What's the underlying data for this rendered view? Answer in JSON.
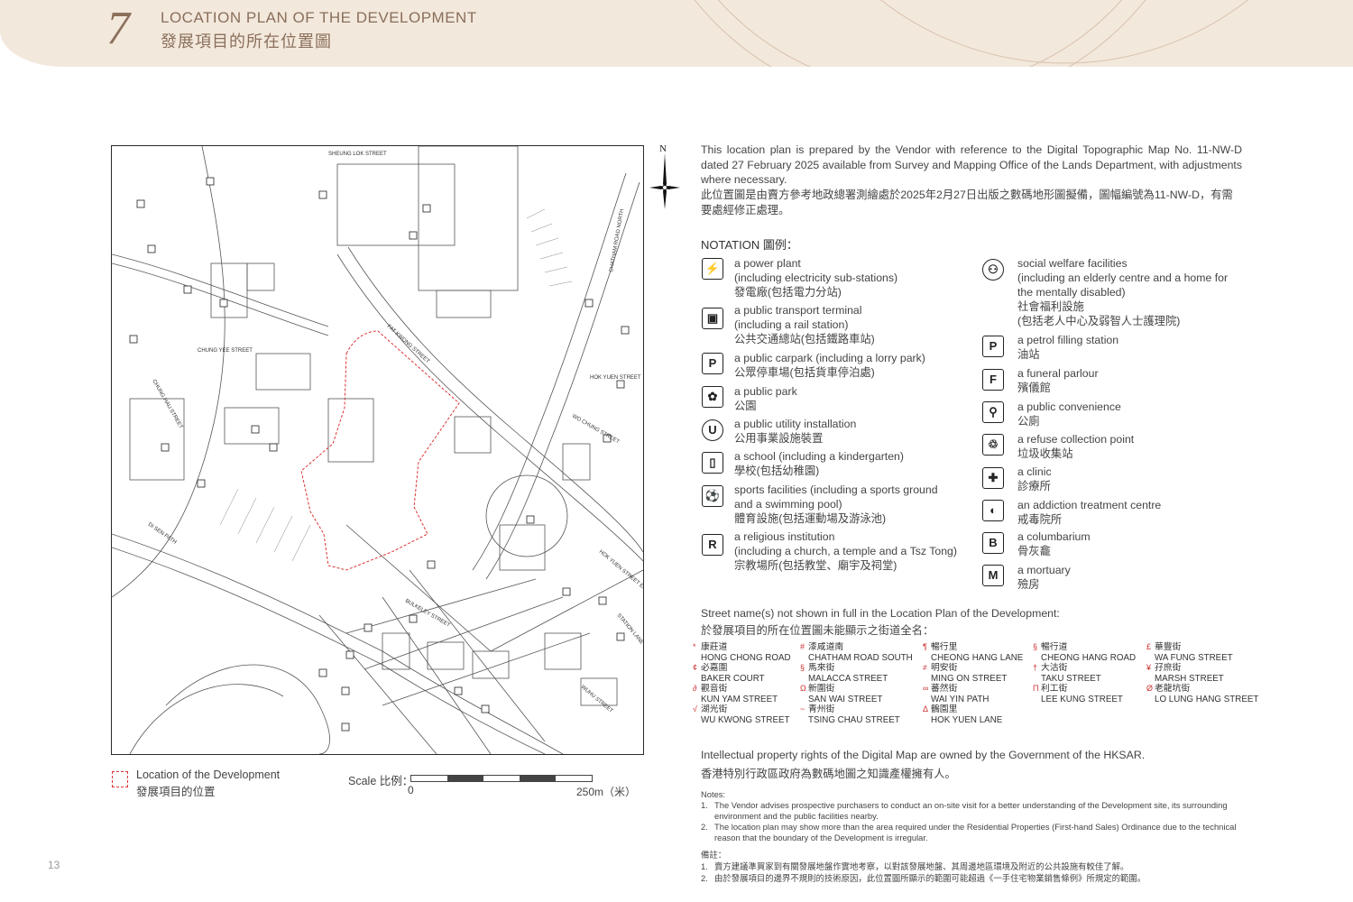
{
  "header": {
    "section_number": "7",
    "title_en": "LOCATION PLAN OF THE DEVELOPMENT",
    "title_zh": "發展項目的所在位置圖"
  },
  "map": {
    "north": "N",
    "labels": [
      "FAT KWONG STREET",
      "CHUNG YEE STREET",
      "CHUNG HAU STREET",
      "DI SEN PATH",
      "CHATHAM ROAD NORTH",
      "WO CHUNG STREET",
      "HOK YUEN STREET",
      "STATION LANE",
      "BULKELEY STREET",
      "WUHU STREET",
      "SHEUNG LOK STREET",
      "HOK YUEN STREET EAST"
    ],
    "legend_location_en": "Location of the Development",
    "legend_location_zh": "發展項目的位置",
    "scale_label": "Scale 比例：",
    "scale_start": "0",
    "scale_end": "250m（米）"
  },
  "intro": {
    "en": "This location plan is prepared by the Vendor with reference to the Digital Topographic Map No. 11-NW-D dated 27 February 2025 available from Survey and Mapping Office of the Lands Department, with adjustments where necessary.",
    "zh": "此位置圖是由賣方參考地政總署測繪處於2025年2月27日出版之數碼地形圖擬備，圖幅編號為11-NW-D，有需要處經修正處理。"
  },
  "notation": {
    "title": "NOTATION 圖例：",
    "left": [
      {
        "icon": "power-plant-icon",
        "glyph": "⚡",
        "en": "a power plant",
        "en2": "(including electricity sub-stations)",
        "zh": "發電廠(包括電力分站)"
      },
      {
        "icon": "bus-terminal-icon",
        "glyph": "▣",
        "en": "a public transport terminal",
        "en2": "(including a rail station)",
        "zh": "公共交通總站(包括鐵路車站)"
      },
      {
        "icon": "carpark-icon",
        "glyph": "P",
        "en": "a public carpark (including a lorry park)",
        "en2": "",
        "zh": "公眾停車場(包括貨車停泊處)"
      },
      {
        "icon": "park-icon",
        "glyph": "✿",
        "en": "a public park",
        "en2": "",
        "zh": "公園"
      },
      {
        "icon": "utility-icon",
        "glyph": "U",
        "en": "a public utility installation",
        "en2": "",
        "zh": "公用事業設施裝置"
      },
      {
        "icon": "school-icon",
        "glyph": "▯",
        "en": "a school (including a kindergarten)",
        "en2": "",
        "zh": "學校(包括幼稚園)"
      },
      {
        "icon": "sports-icon",
        "glyph": "⚽",
        "en": "sports facilities (including a sports ground",
        "en2": "and a swimming pool)",
        "zh": "體育設施(包括運動場及游泳池)"
      },
      {
        "icon": "religious-icon",
        "glyph": "R",
        "en": "a religious institution",
        "en2": "(including a church, a temple and a Tsz Tong)",
        "zh": "宗教場所(包括教堂、廟宇及祠堂)"
      }
    ],
    "right": [
      {
        "icon": "social-welfare-icon",
        "glyph": "⚇",
        "en": "social welfare facilities",
        "en2": "(including an elderly centre and a home for",
        "en3": "the mentally disabled)",
        "zh": "社會福利設施",
        "zh2": "(包括老人中心及弱智人士護理院)"
      },
      {
        "icon": "petrol-icon",
        "glyph": "P",
        "en": "a petrol filling station",
        "zh": "油站"
      },
      {
        "icon": "funeral-icon",
        "glyph": "F",
        "en": "a funeral parlour",
        "zh": "殯儀館"
      },
      {
        "icon": "toilet-icon",
        "glyph": "⚲",
        "en": "a public convenience",
        "zh": "公廁"
      },
      {
        "icon": "refuse-icon",
        "glyph": "♲",
        "en": "a refuse collection point",
        "zh": "垃圾收集站"
      },
      {
        "icon": "clinic-icon",
        "glyph": "✚",
        "en": "a clinic",
        "zh": "診療所"
      },
      {
        "icon": "addiction-icon",
        "glyph": "◐",
        "en": "an addiction treatment centre",
        "zh": "戒毒院所"
      },
      {
        "icon": "columbarium-icon",
        "glyph": "B",
        "en": "a columbarium",
        "zh": "骨灰龕"
      },
      {
        "icon": "mortuary-icon",
        "glyph": "M",
        "en": "a mortuary",
        "zh": "殮房"
      }
    ]
  },
  "streets": {
    "title_en": "Street name(s) not shown in full in the Location Plan of the Development:",
    "title_zh": "於發展項目的所在位置圖未能顯示之街道全名：",
    "items": [
      {
        "sym": "*",
        "zh": "康莊道",
        "en": "HONG CHONG ROAD"
      },
      {
        "sym": "#",
        "zh": "漆咸道南",
        "en": "CHATHAM ROAD SOUTH"
      },
      {
        "sym": "¶",
        "zh": "暢行里",
        "en": "CHEONG HANG LANE"
      },
      {
        "sym": "§",
        "zh": "暢行道",
        "en": "CHEONG HANG ROAD"
      },
      {
        "sym": "£",
        "zh": "華豐街",
        "en": "WA FUNG STREET"
      },
      {
        "sym": "¢",
        "zh": "必嘉圍",
        "en": "BAKER COURT"
      },
      {
        "sym": "§",
        "zh": "馬來街",
        "en": "MALACCA STREET"
      },
      {
        "sym": "≠",
        "zh": "明安街",
        "en": "MING ON STREET"
      },
      {
        "sym": "†",
        "zh": "大沽街",
        "en": "TAKU STREET"
      },
      {
        "sym": "¥",
        "zh": "孖庶街",
        "en": "MARSH STREET"
      },
      {
        "sym": "∂",
        "zh": "觀音街",
        "en": "KUN YAM STREET"
      },
      {
        "sym": "Ω",
        "zh": "新圍街",
        "en": "SAN WAI STREET"
      },
      {
        "sym": "∞",
        "zh": "蕃然街",
        "en": "WAI YIN PATH"
      },
      {
        "sym": "Π",
        "zh": "利工街",
        "en": "LEE KUNG STREET"
      },
      {
        "sym": "Ø",
        "zh": "老龍坑街",
        "en": "LO LUNG HANG STREET"
      },
      {
        "sym": "√",
        "zh": "湖光街",
        "en": "WU KWONG STREET"
      },
      {
        "sym": "~",
        "zh": "青州街",
        "en": "TSING CHAU STREET"
      },
      {
        "sym": "Δ",
        "zh": "鶴園里",
        "en": "HOK YUEN LANE"
      }
    ]
  },
  "ip": {
    "en": "Intellectual property rights of the Digital Map are owned by the Government of the HKSAR.",
    "zh": "香港特別行政區政府為數碼地圖之知識產權擁有人。"
  },
  "notes": {
    "title": "Notes:",
    "items": [
      {
        "n": "1.",
        "t": "The Vendor advises prospective purchasers to conduct an on-site visit for a better understanding of the Development site, its surrounding environment and the public facilities nearby."
      },
      {
        "n": "2.",
        "t": "The location plan may show more than the area required under the Residential Properties (First-hand Sales) Ordinance due to the technical reason that the boundary of the Development is irregular."
      }
    ],
    "title_zh": "備註：",
    "items_zh": [
      {
        "n": "1.",
        "t": "賣方建議準買家到有關發展地盤作實地考察，以對該發展地盤、其周邊地區環境及附近的公共設施有較佳了解。"
      },
      {
        "n": "2.",
        "t": "由於發展項目的邊界不規則的技術原因，此位置圖所顯示的範圍可能超過《一手住宅物業銷售條例》所規定的範圍。"
      }
    ]
  },
  "page_number": "13"
}
